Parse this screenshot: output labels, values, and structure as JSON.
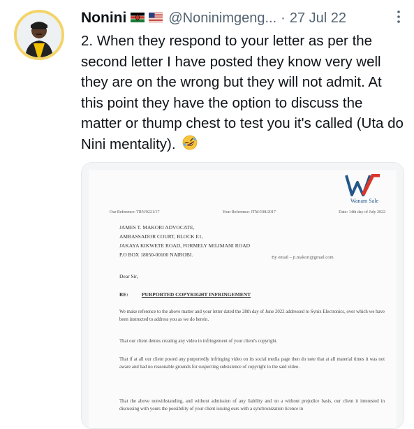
{
  "tweet": {
    "author_name": "Nonini",
    "handle": "@Noninimgeng...",
    "separator": "·",
    "date": "27 Jul 22",
    "text": "2. When they respond to your letter as per the second letter I have posted they know very well they are on the wrong but they will not admit. At this point they have the option to discuss the matter or thump chest to test you it's called (Uta do Nini mentality).",
    "trailing_emoji": "rolling-on-floor-laughing-emoji",
    "flags": [
      "kenya-flag-icon",
      "usa-flag-icon"
    ],
    "more_icon": "more-vertical-icon"
  },
  "document": {
    "logo_text": "Wanam Sale",
    "our_ref": "Our Reference: TRN/0221/17",
    "your_ref": "Your Reference: JTM/198/2017",
    "date": "Date: 14th day of July 2022",
    "recipient_lines": [
      "JAMES T. MAKORI ADVOCATE,",
      "AMBASSADOR COURT, BLOCK E1,",
      "JAKAYA KIKWETE ROAD, FORMELY MILIMANI ROAD",
      "P.O BOX 18050-00100 NAIROBI."
    ],
    "by_email": "By email – jt.makori@gmail.com",
    "salutation": "Dear Sir,",
    "re_label": "RE:",
    "re_subject": "PURPORTED COPYRIGHT INFRINGEMENT",
    "paragraphs": [
      "We make reference to the above matter and your letter dated the 28th day of June 2022 addressed to Synix Electronics, over which we have been instructed to address you as we do herein.",
      "That our client denies creating any video in infringement of your client's copyright.",
      "That if at all our client posted any purportedly infringing video on its social media page then do note that at all material times it was not aware and had no reasonable grounds for suspecting subsistence of copyright to the said video.",
      "That the above notwithstanding, and without admission of any liability and on a without prejudice basis, our client it interested in discussing with yours the possibility of your client issuing ours with a synchronization licence in"
    ]
  },
  "colors": {
    "text": "#0f1419",
    "muted": "#536471",
    "avatar_ring": "#f3d46a",
    "logo_red": "#d9372b",
    "logo_blue": "#24568a"
  }
}
